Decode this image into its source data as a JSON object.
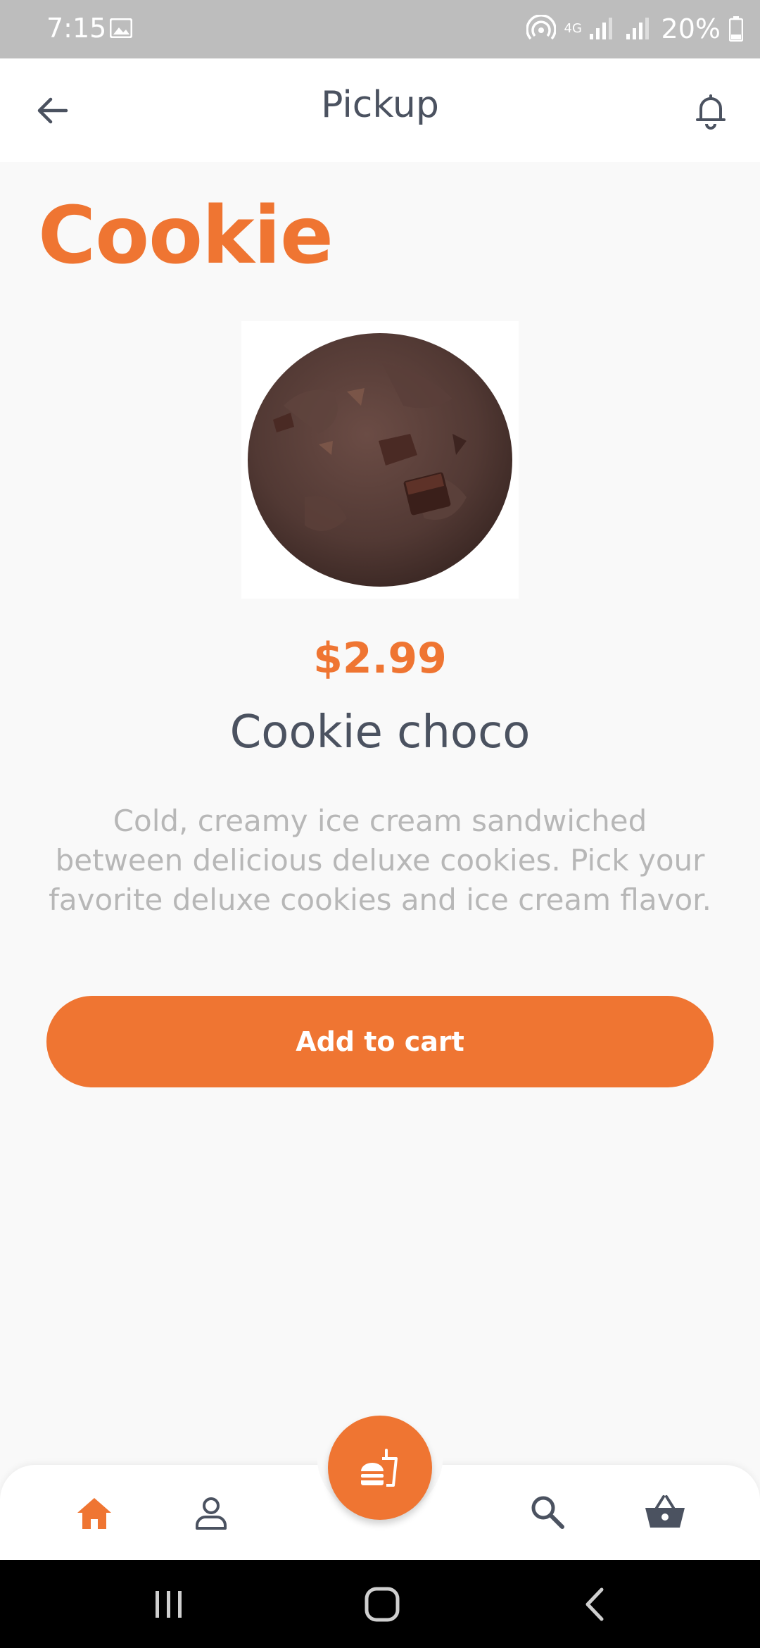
{
  "status_bar": {
    "time": "7:15",
    "network": "4G",
    "battery": "20%"
  },
  "app_bar": {
    "title": "Pickup"
  },
  "category": {
    "title": "Cookie"
  },
  "product": {
    "price": "$2.99",
    "name": "Cookie choco",
    "description": "Cold, creamy ice cream sandwiched between delicious deluxe cookies. Pick your favorite deluxe cookies and ice cream flavor."
  },
  "actions": {
    "add_to_cart_label": "Add to cart"
  },
  "bottom_nav": {
    "items": [
      {
        "icon": "home-icon",
        "active": true
      },
      {
        "icon": "person-icon",
        "active": false
      },
      {
        "icon": "menu-food-icon",
        "active": true
      },
      {
        "icon": "search-icon",
        "active": false
      },
      {
        "icon": "basket-icon",
        "active": false
      }
    ]
  },
  "colors": {
    "accent": "#ef7532",
    "text_dark": "#4b5260",
    "text_muted": "#b7b7b7",
    "background": "#f9f9f9"
  }
}
